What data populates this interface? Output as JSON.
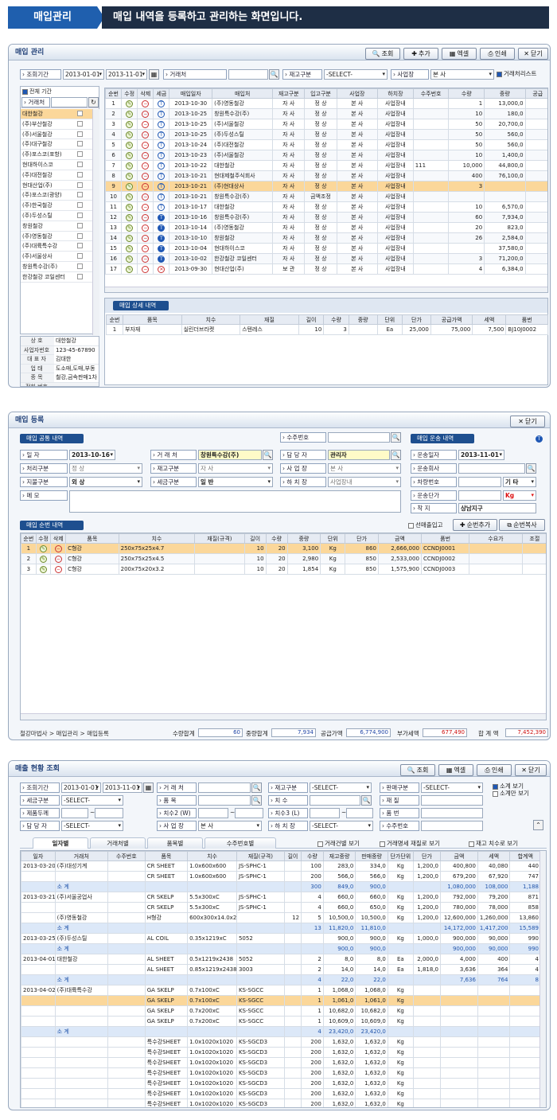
{
  "header": {
    "tag": "매입관리",
    "desc": "매입 내역을 등록하고 관리하는 화면입니다."
  },
  "w1": {
    "title": "매입 관리",
    "buttons": [
      "조회",
      "추가",
      "엑셀",
      "인쇄",
      "닫기"
    ],
    "filter": {
      "period_label": "조회기간",
      "date_from": "2013-01-01",
      "date_to": "2013-11-01",
      "vendor_label": "거래처",
      "stock_label": "재고구분",
      "stock_value": "-SELECT-",
      "site_label": "사업장",
      "site_value": "본 사",
      "vendor_list_chk": "거래처리스트"
    },
    "sidebar": {
      "all_period": "전체 기간",
      "vendor_label": "거래처",
      "vendors": [
        "대한철강",
        "(주)부산철강",
        "(주)서울철강",
        "(주)대구철강",
        "(주)포스코(포항)",
        "현대하이스코",
        "(주)대전철강",
        "현대산업(주)",
        "(주)포스코(광양)",
        "(주)한국철강",
        "(주)두성스틸",
        "창원철강",
        "(주)영동철강",
        "(주)대륙특수강",
        "(주)서울상사",
        "창원특수강(주)",
        "한강철강 코일센터"
      ],
      "info": [
        {
          "k": "상 호",
          "v": "대한철강"
        },
        {
          "k": "사업자번호",
          "v": "123-45-67890"
        },
        {
          "k": "대 표 자",
          "v": "김대한"
        },
        {
          "k": "업 태",
          "v": "도소매,도매,부동"
        },
        {
          "k": "종 목",
          "v": "철강,금속판매1차"
        },
        {
          "k": "전화 번호",
          "v": ""
        },
        {
          "k": "팩스 번호",
          "v": ""
        },
        {
          "k": "휴대 전화",
          "v": ""
        },
        {
          "k": "채권 한도",
          "v": ""
        }
      ]
    },
    "grid_cols": [
      "순번",
      "수정",
      "삭제",
      "세금",
      "매입일자",
      "매입처",
      "재고구분",
      "입고구분",
      "사업장",
      "하치장",
      "수주번호",
      "수량",
      "중량",
      "공급"
    ],
    "rows": [
      [
        "1",
        "2013-10-30",
        "(주)영동철강",
        "자 사",
        "정 상",
        "본 사",
        "사업장내",
        "",
        "1",
        "13,000,0",
        "A"
      ],
      [
        "2",
        "2013-10-25",
        "창원특수강(주)",
        "자 사",
        "정 상",
        "본 사",
        "사업장내",
        "",
        "10",
        "180,0",
        "A"
      ],
      [
        "3",
        "2013-10-25",
        "(주)서울철강",
        "자 사",
        "정 상",
        "본 사",
        "사업장내",
        "",
        "50",
        "20,700,0",
        "A"
      ],
      [
        "4",
        "2013-10-25",
        "(주)두성스틸",
        "자 사",
        "정 상",
        "본 사",
        "사업장내",
        "",
        "50",
        "560,0",
        "A"
      ],
      [
        "5",
        "2013-10-24",
        "(주)대전철강",
        "자 사",
        "정 상",
        "본 사",
        "사업장내",
        "",
        "50",
        "560,0",
        "A"
      ],
      [
        "6",
        "2013-10-23",
        "(주)서울철강",
        "자 사",
        "정 상",
        "본 사",
        "사업장내",
        "",
        "10",
        "1,400,0",
        "A"
      ],
      [
        "7",
        "2013-10-22",
        "대한철강",
        "자 사",
        "정 상",
        "본 사",
        "사업장내",
        "111",
        "10,000",
        "44,800,0",
        "A"
      ],
      [
        "8",
        "2013-10-21",
        "현대제철주식회사",
        "자 사",
        "정 상",
        "본 사",
        "사업장내",
        "",
        "400",
        "76,100,0",
        "A"
      ],
      [
        "9",
        "2013-10-21",
        "(주)현대상사",
        "자 사",
        "정 상",
        "본 사",
        "사업장내",
        "",
        "3",
        "",
        "A"
      ],
      [
        "10",
        "2013-10-21",
        "창원특수강(주)",
        "자 사",
        "금액조정",
        "본 사",
        "사업장내",
        "",
        "",
        "",
        "A"
      ],
      [
        "11",
        "2013-10-17",
        "대한철강",
        "자 사",
        "정 상",
        "본 사",
        "사업장내",
        "",
        "10",
        "6,570,0",
        "A"
      ],
      [
        "12",
        "2013-10-16",
        "창원특수강(주)",
        "자 사",
        "정 상",
        "본 사",
        "사업장내",
        "",
        "60",
        "7,934,0",
        "B"
      ],
      [
        "13",
        "2013-10-14",
        "(주)영동철강",
        "자 사",
        "정 상",
        "본 사",
        "사업장내",
        "",
        "20",
        "823,0",
        "B"
      ],
      [
        "14",
        "2013-10-10",
        "창원철강",
        "자 사",
        "정 상",
        "본 사",
        "사업장내",
        "",
        "26",
        "2,584,0",
        "B"
      ],
      [
        "15",
        "2013-10-04",
        "현대하이스코",
        "자 사",
        "정 상",
        "본 사",
        "사업장내",
        "",
        "",
        "37,580,0",
        "B"
      ],
      [
        "16",
        "2013-10-02",
        "한강철강 코일센터",
        "자 사",
        "정 상",
        "본 사",
        "사업장내",
        "",
        "3",
        "71,200,0",
        "B"
      ],
      [
        "17",
        "2013-09-30",
        "현대산업(주)",
        "보 관",
        "정 상",
        "본 사",
        "사업장내",
        "",
        "4",
        "6,384,0",
        "X"
      ]
    ],
    "detail": {
      "title": "매입 상세 내역",
      "cols": [
        "순번",
        "품목",
        "치수",
        "재질",
        "길이",
        "수량",
        "중량",
        "단위",
        "단가",
        "공급가액",
        "세액",
        "품번"
      ],
      "rows": [
        [
          "1",
          "부자재",
          "실린더브라켓",
          "스텐레스",
          "10",
          "3",
          "",
          "Ea",
          "25,000",
          "75,000",
          "7,500",
          "BJ10J0002"
        ]
      ]
    }
  },
  "w2": {
    "title": "매입 등록",
    "close": "닫기",
    "common_title": "매입 공통 내역",
    "order_label": "수주번호",
    "ship_title": "매입 운송 내역",
    "date_label": "일 자",
    "date": "2013-10-16",
    "vendor_label": "거 래 처",
    "vendor": "창원특수강(주)",
    "mgr_label": "담 당 자",
    "mgr": "관리자",
    "proc_label": "처리구분",
    "proc": "정 상",
    "stock_label": "재고구분",
    "stock": "자 사",
    "site_label": "사 업 장",
    "site": "본 사",
    "pay_label": "지불구분",
    "pay": "외 상",
    "tax_label": "세금구분",
    "tax": "일 반",
    "yard_label": "하 치 장",
    "yard": "사업장내",
    "memo_label": "메 모",
    "ship_date_label": "운송일자",
    "ship_date": "2013-11-01",
    "ship_co_label": "운송회사",
    "car_label": "차량번호",
    "car_type": "기 타",
    "ship_price_label": "운송단가",
    "unit": "Kg",
    "dest_label": "착 지",
    "dest": "상남지구",
    "item_title": "매입 순번 내역",
    "chk_label": "선매출입고",
    "add_btn": "순번추가",
    "copy_btn": "순번복사",
    "cols": [
      "순번",
      "수정",
      "삭제",
      "품목",
      "치수",
      "재질(규격)",
      "길이",
      "수량",
      "중량",
      "단위",
      "단가",
      "금액",
      "품번",
      "수요가",
      "조절"
    ],
    "rows": [
      [
        "1",
        "C형강",
        "250x75x25x4.7",
        "",
        "10",
        "20",
        "3,100",
        "Kg",
        "860",
        "2,666,000",
        "CCNDJ0001"
      ],
      [
        "2",
        "C형강",
        "250x75x25x4.5",
        "",
        "10",
        "20",
        "2,980",
        "Kg",
        "850",
        "2,533,000",
        "CCNDJ0002"
      ],
      [
        "3",
        "C형강",
        "200x75x20x3.2",
        "",
        "10",
        "20",
        "1,854",
        "Kg",
        "850",
        "1,575,900",
        "CCNDJ0003"
      ]
    ],
    "breadcrumb": "철강마법사 > 매입관리 > 매입등록",
    "sum": {
      "qty_label": "수량합계",
      "qty": "60",
      "wt_label": "중량합계",
      "wt": "7,934",
      "supply_label": "공급가액",
      "supply": "6,774,900",
      "vat_label": "부가세액",
      "vat": "677,490",
      "total_label": "합 계 액",
      "total": "7,452,390"
    }
  },
  "w3": {
    "title": "매출 현황 조회",
    "buttons": [
      "조회",
      "엑셀",
      "인쇄",
      "닫기"
    ],
    "f": {
      "period": "조회기간",
      "from": "2013-01-01",
      "to": "2013-11-01",
      "vendor": "거 래 처",
      "stock": "재고구분",
      "stock_v": "-SELECT-",
      "sale": "판매구분",
      "sale_v": "-SELECT-",
      "tax": "세금구분",
      "tax_v": "-SELECT-",
      "item": "품 목",
      "size": "치 수",
      "material": "재 질",
      "thick": "제품두께",
      "size_w": "치수2 (W)",
      "size_l": "치수3 (L)",
      "partno": "품 번",
      "mgr": "담 당 자",
      "mgr_v": "-SELECT-",
      "site": "사 업 장",
      "site_v": "본 사",
      "yard": "하 치 장",
      "yard_v": "-SELECT-",
      "order": "수주번호",
      "chk1": "소계 보기",
      "chk2": "소계만 보기"
    },
    "tabs": [
      "일자별",
      "거래처별",
      "품목별",
      "수주번호별"
    ],
    "opts": [
      "거래건별 보기",
      "거래명세 재질로 보기",
      "재고 치수로 보기"
    ],
    "cols": [
      "일자",
      "거래처",
      "수주번호",
      "품목",
      "치수",
      "재질(규격)",
      "길이",
      "수량",
      "재고중량",
      "판매중량",
      "단가단위",
      "단가",
      "금액",
      "세액",
      "합계액"
    ],
    "rows": [
      {
        "t": "n",
        "c": [
          "2013-03-20",
          "(주)대성기계",
          "",
          "CR SHEET",
          "1.0x600x600",
          "JS-SPHC-1",
          "",
          "100",
          "283,0",
          "334,0",
          "Kg",
          "1,200,0",
          "400,800",
          "40,080",
          "440"
        ]
      },
      {
        "t": "n",
        "c": [
          "",
          "",
          "",
          "CR SHEET",
          "1.0x600x600",
          "JS-SPHC-1",
          "",
          "200",
          "566,0",
          "566,0",
          "Kg",
          "1,200,0",
          "679,200",
          "67,920",
          "747"
        ]
      },
      {
        "t": "s",
        "c": [
          "",
          "소 계",
          "",
          "",
          "",
          "",
          "",
          "300",
          "849,0",
          "900,0",
          "",
          "",
          "1,080,000",
          "108,000",
          "1,188"
        ]
      },
      {
        "t": "n",
        "c": [
          "2013-03-21",
          "(주)서울공업사",
          "",
          "CR SKELP",
          "5.5x300xC",
          "JS-SPHC-1",
          "",
          "4",
          "660,0",
          "660,0",
          "Kg",
          "1,200,0",
          "792,000",
          "79,200",
          "871"
        ]
      },
      {
        "t": "n",
        "c": [
          "",
          "",
          "",
          "CR SKELP",
          "5.5x300xC",
          "JS-SPHC-1",
          "",
          "4",
          "660,0",
          "650,0",
          "Kg",
          "1,200,0",
          "780,000",
          "78,000",
          "858"
        ]
      },
      {
        "t": "n",
        "c": [
          "",
          "(주)영동철강",
          "",
          "H형강",
          "600x300x14.0x23",
          "",
          "12",
          "5",
          "10,500,0",
          "10,500,0",
          "Kg",
          "1,200,0",
          "12,600,000",
          "1,260,000",
          "13,860"
        ]
      },
      {
        "t": "s",
        "c": [
          "",
          "소 계",
          "",
          "",
          "",
          "",
          "",
          "13",
          "11,820,0",
          "11,810,0",
          "",
          "",
          "14,172,000",
          "1,417,200",
          "15,589"
        ]
      },
      {
        "t": "n",
        "c": [
          "2013-03-25",
          "(주)두성스틸",
          "",
          "AL COIL",
          "0.35x1219xC",
          "5052",
          "",
          "",
          "900,0",
          "900,0",
          "Kg",
          "1,000,0",
          "900,000",
          "90,000",
          "990"
        ]
      },
      {
        "t": "s",
        "c": [
          "",
          "소 계",
          "",
          "",
          "",
          "",
          "",
          "",
          "900,0",
          "900,0",
          "",
          "",
          "900,000",
          "90,000",
          "990"
        ]
      },
      {
        "t": "n",
        "c": [
          "2013-04-01",
          "대한철강",
          "",
          "AL SHEET",
          "0.5x1219x2438",
          "5052",
          "",
          "2",
          "8,0",
          "8,0",
          "Ea",
          "2,000,0",
          "4,000",
          "400",
          "4"
        ]
      },
      {
        "t": "n",
        "c": [
          "",
          "",
          "",
          "AL SHEET",
          "0.85x1219x2438",
          "3003",
          "",
          "2",
          "14,0",
          "14,0",
          "Ea",
          "1,818,0",
          "3,636",
          "364",
          "4"
        ]
      },
      {
        "t": "s",
        "c": [
          "",
          "소 계",
          "",
          "",
          "",
          "",
          "",
          "4",
          "22,0",
          "22,0",
          "",
          "",
          "7,636",
          "764",
          "8"
        ]
      },
      {
        "t": "n",
        "c": [
          "2013-04-02",
          "(주)대륙특수강",
          "",
          "GA SKELP",
          "0.7x100xC",
          "KS-SGCC",
          "",
          "1",
          "1,068,0",
          "1,068,0",
          "Kg",
          "",
          "",
          "",
          ""
        ]
      },
      {
        "t": "h",
        "c": [
          "",
          "",
          "",
          "GA SKELP",
          "0.7x100xC",
          "KS-SGCC",
          "",
          "1",
          "1,061,0",
          "1,061,0",
          "Kg",
          "",
          "",
          "",
          ""
        ]
      },
      {
        "t": "n",
        "c": [
          "",
          "",
          "",
          "GA SKELP",
          "0.7x200xC",
          "KS-SGCC",
          "",
          "1",
          "10,682,0",
          "10,682,0",
          "Kg",
          "",
          "",
          "",
          ""
        ]
      },
      {
        "t": "n",
        "c": [
          "",
          "",
          "",
          "GA SKELP",
          "0.7x200xC",
          "KS-SGCC",
          "",
          "1",
          "10,609,0",
          "10,609,0",
          "Kg",
          "",
          "",
          "",
          ""
        ]
      },
      {
        "t": "s",
        "c": [
          "",
          "소 계",
          "",
          "",
          "",
          "",
          "",
          "4",
          "23,420,0",
          "23,420,0",
          "",
          "",
          "",
          "",
          ""
        ]
      },
      {
        "t": "n",
        "c": [
          "",
          "",
          "",
          "특수강SHEET",
          "1.0x1020x1020",
          "KS-SGCD3",
          "",
          "200",
          "1,632,0",
          "1,632,0",
          "Kg",
          "",
          "",
          "",
          ""
        ]
      },
      {
        "t": "n",
        "c": [
          "",
          "",
          "",
          "특수강SHEET",
          "1.0x1020x1020",
          "KS-SGCD3",
          "",
          "200",
          "1,632,0",
          "1,632,0",
          "Kg",
          "",
          "",
          "",
          ""
        ]
      },
      {
        "t": "n",
        "c": [
          "",
          "",
          "",
          "특수강SHEET",
          "1.0x1020x1020",
          "KS-SGCD3",
          "",
          "200",
          "1,632,0",
          "1,632,0",
          "Kg",
          "",
          "",
          "",
          ""
        ]
      },
      {
        "t": "n",
        "c": [
          "",
          "",
          "",
          "특수강SHEET",
          "1.0x1020x1020",
          "KS-SGCD3",
          "",
          "200",
          "1,632,0",
          "1,632,0",
          "Kg",
          "",
          "",
          "",
          ""
        ]
      },
      {
        "t": "n",
        "c": [
          "",
          "",
          "",
          "특수강SHEET",
          "1.0x1020x1020",
          "KS-SGCD3",
          "",
          "200",
          "1,632,0",
          "1,632,0",
          "Kg",
          "",
          "",
          "",
          ""
        ]
      },
      {
        "t": "n",
        "c": [
          "",
          "",
          "",
          "특수강SHEET",
          "1.0x1020x1020",
          "KS-SGCD3",
          "",
          "200",
          "1,632,0",
          "1,632,0",
          "Kg",
          "",
          "",
          "",
          ""
        ]
      },
      {
        "t": "n",
        "c": [
          "",
          "",
          "",
          "특수강SHEET",
          "1.0x1020x1020",
          "KS-SGCD3",
          "",
          "200",
          "1,632,0",
          "1,632,0",
          "Kg",
          "",
          "",
          "",
          ""
        ]
      },
      {
        "t": "n",
        "c": [
          "",
          "",
          "",
          "특수강SHEET",
          "1.0x1020x1020",
          "KS-SGCD3",
          "",
          "200",
          "1,632,0",
          "1,632,0",
          "Kg",
          "",
          "",
          "",
          ""
        ]
      }
    ]
  }
}
